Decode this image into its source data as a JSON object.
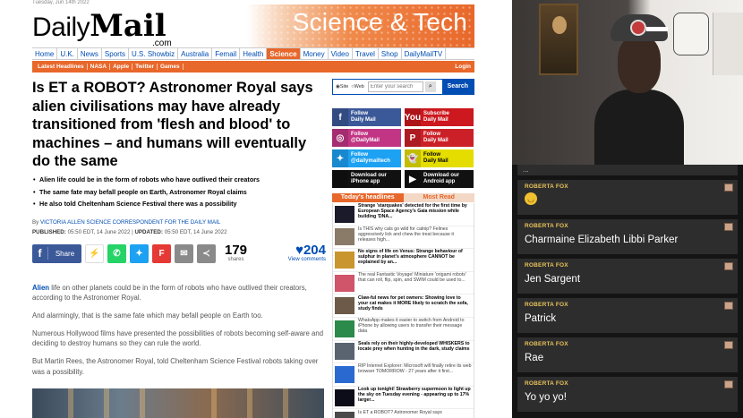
{
  "article_page": {
    "topline": "Tuesday, Jun 14th 2022",
    "logo_daily": "Daily",
    "logo_mail": "Mail",
    "logo_com": ".com",
    "channel_title": "Science & Tech",
    "main_nav": [
      "Home",
      "U.K.",
      "News",
      "Sports",
      "U.S. Showbiz",
      "Australia",
      "Femail",
      "Health",
      "Science",
      "Money",
      "Video",
      "Travel",
      "Shop",
      "DailyMailTV"
    ],
    "active_nav": "Science",
    "sub_nav": [
      "Latest Headlines",
      "NASA",
      "Apple",
      "Twitter",
      "Games"
    ],
    "login": "Login",
    "headline": "Is ET a ROBOT? Astronomer Royal says alien civilisations may have already transitioned from 'flesh and blood' to machines – and humans will eventually do the same",
    "bullets": [
      "Alien life could be in the form of robots who have outlived their creators",
      "The same fate may befall people on Earth, Astronomer Royal claims",
      "He also told Cheltenham Science Festival there was a possibility"
    ],
    "byline_prefix": "By",
    "byline_author": "VICTORIA ALLEN SCIENCE CORRESPONDENT FOR THE DAILY MAIL",
    "published_label": "PUBLISHED:",
    "published_value": "05:50 EDT, 14 June 2022",
    "updated_label": "UPDATED:",
    "updated_value": "05:50 EDT, 14 June 2022",
    "share_label": "Share",
    "shares_count": "179",
    "shares_caption": "shares",
    "comments_count": "204",
    "comments_caption": "View comments",
    "body": {
      "p1_link": "Alien",
      "p1_rest": " life on other planets could be in the form of robots who have outlived their creators, according to the Astronomer Royal.",
      "p2": "And alarmingly, that is the same fate which may befall people on Earth too.",
      "p3": "Numerous Hollywood films have presented the possibilities of robots becoming self-aware and deciding to destroy humans so they can rule the world.",
      "p4": "But Martin Rees, the Astronomer Royal, told Cheltenham Science Festival robots taking over was a possibility."
    }
  },
  "sidebar": {
    "search_radio_site": "Site",
    "search_radio_web": "Web",
    "search_placeholder": "Enter your search",
    "search_button": "Search",
    "follow": [
      {
        "line1": "Follow",
        "line2": "Daily Mail",
        "color": "#3b5998",
        "icon": "f"
      },
      {
        "line1": "Subscribe",
        "line2": "Daily Mail",
        "color": "#cc181e",
        "icon": "You"
      },
      {
        "line1": "Follow",
        "line2": "@DailyMail",
        "color": "#c13584",
        "icon": "◎"
      },
      {
        "line1": "Follow",
        "line2": "Daily Mail",
        "color": "#cb2027",
        "icon": "P"
      },
      {
        "line1": "Follow",
        "line2": "@dailymailtech",
        "color": "#1da1f2",
        "icon": "✦"
      },
      {
        "line1": "Follow",
        "line2": "Daily Mail",
        "color": "#e5dd00",
        "icon": "👻"
      },
      {
        "line1": "Download our",
        "line2": "iPhone app",
        "color": "#111111",
        "icon": ""
      },
      {
        "line1": "Download our",
        "line2": "Android app",
        "color": "#111111",
        "icon": "▶"
      }
    ],
    "tab_headlines": "Today's headlines",
    "tab_most_read": "Most Read",
    "headlines": [
      {
        "text": "Strange 'starquakes' detected for the first time by European Space Agency's Gaia mission while building 'DNA...",
        "bold": true,
        "thumb": "#1a1a2a"
      },
      {
        "text": "Is THIS why cats go wild for catnip? Felines aggressively lick and chew the treat because it releases high...",
        "bold": false,
        "thumb": "#8a7a68"
      },
      {
        "text": "No signs of life on Venus: Strange behaviour of sulphur in planet's atmosphere CANNOT be explained by an...",
        "bold": true,
        "thumb": "#c9952e"
      },
      {
        "text": "The real Fantastic Voyage! Miniature 'origami robots' that can roll, flip, spin, and SWIM could be used to...",
        "bold": false,
        "thumb": "#d0546a"
      },
      {
        "text": "Claw-ful news for pet owners: Showing love to your cat makes it MORE likely to scratch the sofa, study finds",
        "bold": true,
        "thumb": "#6e5a48"
      },
      {
        "text": "WhatsApp makes it easier to switch from Android to iPhone by allowing users to transfer their message data",
        "bold": false,
        "thumb": "#2c8a4a"
      },
      {
        "text": "Seals rely on their highly-developed WHISKERS to locate prey when hunting in the dark, study claims",
        "bold": true,
        "thumb": "#5a6470"
      },
      {
        "text": "RIP Internet Explorer: Microsoft will finally retire its web browser TOMORROW - 27 years after it first...",
        "bold": false,
        "thumb": "#2a6ad0"
      },
      {
        "text": "Look up tonight! Strawberry supermoon to light up the sky on Tuesday evening - appearing up to 17% larger...",
        "bold": true,
        "thumb": "#0d0d1a"
      },
      {
        "text": "Is ET a ROBOT? Astronomer Royal says",
        "bold": false,
        "thumb": "#4a4a4a"
      }
    ]
  },
  "stream": {
    "chat_top_fragment": "...",
    "messages": [
      {
        "name": "ROBERTA FOX",
        "text": "",
        "emoji": true
      },
      {
        "name": "ROBERTA FOX",
        "text": "Charmaine Elizabeth Libbi Parker",
        "emoji": false
      },
      {
        "name": "ROBERTA FOX",
        "text": "Jen Sargent",
        "emoji": false
      },
      {
        "name": "ROBERTA FOX",
        "text": "Patrick",
        "emoji": false
      },
      {
        "name": "ROBERTA FOX",
        "text": "Rae",
        "emoji": false
      },
      {
        "name": "ROBERTA FOX",
        "text": "Yo yo yo!",
        "emoji": false
      }
    ]
  }
}
